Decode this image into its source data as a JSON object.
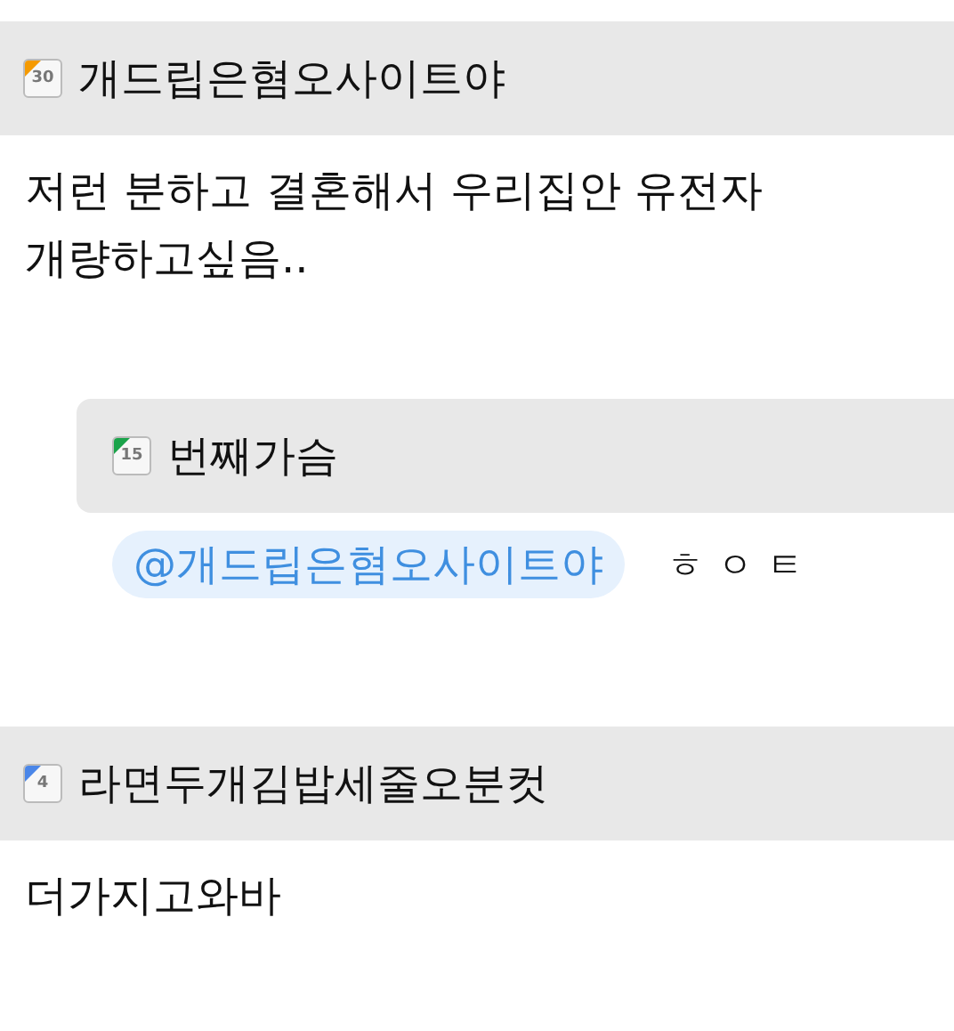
{
  "comments": [
    {
      "author": {
        "level": "30",
        "color": "#f59a00",
        "name": "개드립은혐오사이트야"
      },
      "body": "저런 분하고 결혼해서 우리집안 유전자 개량하고싶음..",
      "replies": [
        {
          "author": {
            "level": "15",
            "color": "#1aa34a",
            "name": "번째가슴"
          },
          "mention": "@개드립은혐오사이트야",
          "body": "ㅎㅇㅌ"
        }
      ]
    },
    {
      "author": {
        "level": "4",
        "color": "#4a86e8",
        "name": "라면두개김밥세줄오분컷"
      },
      "body": "더가지고와바"
    }
  ]
}
